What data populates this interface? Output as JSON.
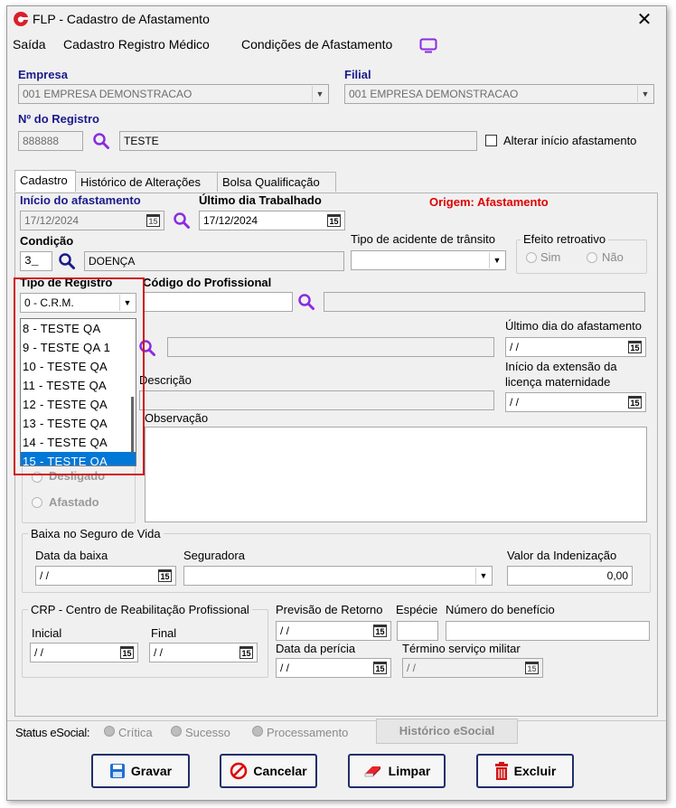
{
  "window": {
    "title": "FLP - Cadastro de Afastamento"
  },
  "menu": {
    "items": [
      "Saída",
      "Cadastro Registro Médico",
      "Condições de Afastamento"
    ]
  },
  "empresa": {
    "label": "Empresa",
    "value": "001 EMPRESA DEMONSTRACAO"
  },
  "filial": {
    "label": "Filial",
    "value": "001 EMPRESA DEMONSTRACAO"
  },
  "registro": {
    "label": "Nº do Registro",
    "number": "888888",
    "name": "TESTE",
    "alterar_label": "Alterar início afastamento"
  },
  "tabs": [
    "Cadastro",
    "Histórico de Alterações",
    "Bolsa Qualificação"
  ],
  "cadastro": {
    "inicio_label": "Início do afastamento",
    "inicio_value": "17/12/2024",
    "ultimo_trab_label": "Último dia Trabalhado",
    "ultimo_trab_value": "17/12/2024",
    "origem_label": "Origem: Afastamento",
    "condicao_label": "Condição",
    "condicao_code": "3_",
    "condicao_desc": "DOENÇA",
    "tipo_acidente_label": "Tipo de acidente de trânsito",
    "efeito_label": "Efeito retroativo",
    "efeito_sim": "Sim",
    "efeito_nao": "Não",
    "tipo_registro_label": "Tipo de Registro",
    "tipo_registro_value": "0  - C.R.M.",
    "codigo_prof_label": "Código do Profissional",
    "ultimo_afast_label": "Último dia do afastamento",
    "ultimo_afast_value": " / /",
    "descricao_label": "Descrição",
    "licenca_label_1": "Início da extensão da",
    "licenca_label_2": "licença maternidade",
    "licenca_value": " / /",
    "observacao_label": "Observação",
    "radio_desligado": "Desligado",
    "radio_afastado": "Afastado"
  },
  "tipo_registro_list": {
    "items": [
      "8  - TESTE QA",
      "9  - TESTE QA 1",
      "10  - TESTE QA",
      "11  - TESTE QA",
      "12  - TESTE QA",
      "13  - TESTE QA",
      "14  - TESTE QA",
      "15 - TESTE QA"
    ],
    "selected_index": 7
  },
  "baixa": {
    "title": "Baixa no Seguro de Vida",
    "data_label": "Data da baixa",
    "data_value": " / /",
    "seguradora_label": "Seguradora",
    "valor_label": "Valor da Indenização",
    "valor_value": "0,00"
  },
  "crp": {
    "title": "CRP - Centro de Reabilitação Profissional",
    "inicial_label": "Inicial",
    "inicial_value": " / /",
    "final_label": "Final",
    "final_value": " / /",
    "previsao_label": "Previsão de Retorno",
    "previsao_value": " / /",
    "especie_label": "Espécie",
    "numero_label": "Número do benefício",
    "pericia_label": "Data da perícia",
    "pericia_value": " / /",
    "termino_label": "Término serviço militar",
    "termino_value": " / /"
  },
  "status": {
    "label": "Status eSocial:",
    "critica": "Crítica",
    "sucesso": "Sucesso",
    "processamento": "Processamento",
    "historico_button": "Histórico eSocial"
  },
  "buttons": {
    "gravar": "Gravar",
    "cancelar": "Cancelar",
    "limpar": "Limpar",
    "excluir": "Excluir"
  },
  "colors": {
    "label_blue": "#1a1a8c",
    "origem_red": "#e00000",
    "selection": "#0078d7",
    "highlight": "#d01414",
    "icon_purple": "#8a2be2"
  }
}
